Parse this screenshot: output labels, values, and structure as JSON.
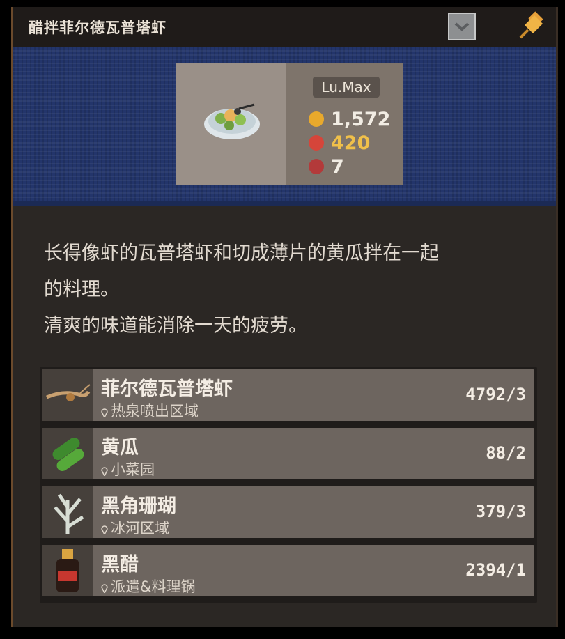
{
  "title": "醋拌菲尔德瓦普塔虾",
  "card": {
    "level": "Lu.Max",
    "stats": [
      {
        "icon": "gold-coin-icon",
        "value": "1,572",
        "color": "#f2ede4",
        "icon_color": "#e8a92c"
      },
      {
        "icon": "cooking-pot-icon",
        "value": "420",
        "color": "#f0c04a",
        "icon_color": "#d6453a"
      },
      {
        "icon": "food-bowl-icon",
        "value": "7",
        "color": "#f2ede4",
        "icon_color": "#b33a3a"
      }
    ]
  },
  "description": [
    "长得像虾的瓦普塔虾和切成薄片的黄瓜拌在一起",
    "的料理。",
    "清爽的味道能消除一天的疲劳。"
  ],
  "ingredients": [
    {
      "name": "菲尔德瓦普塔虾",
      "location": "热泉喷出区域",
      "count": "4792/3",
      "icon": "shrimp-icon"
    },
    {
      "name": "黄瓜",
      "location": "小菜园",
      "count": "88/2",
      "icon": "cucumber-icon"
    },
    {
      "name": "黑角珊瑚",
      "location": "冰河区域",
      "count": "379/3",
      "icon": "coral-icon"
    },
    {
      "name": "黑醋",
      "location": "派遣&料理锅",
      "count": "2394/1",
      "icon": "vinegar-bottle-icon"
    }
  ]
}
